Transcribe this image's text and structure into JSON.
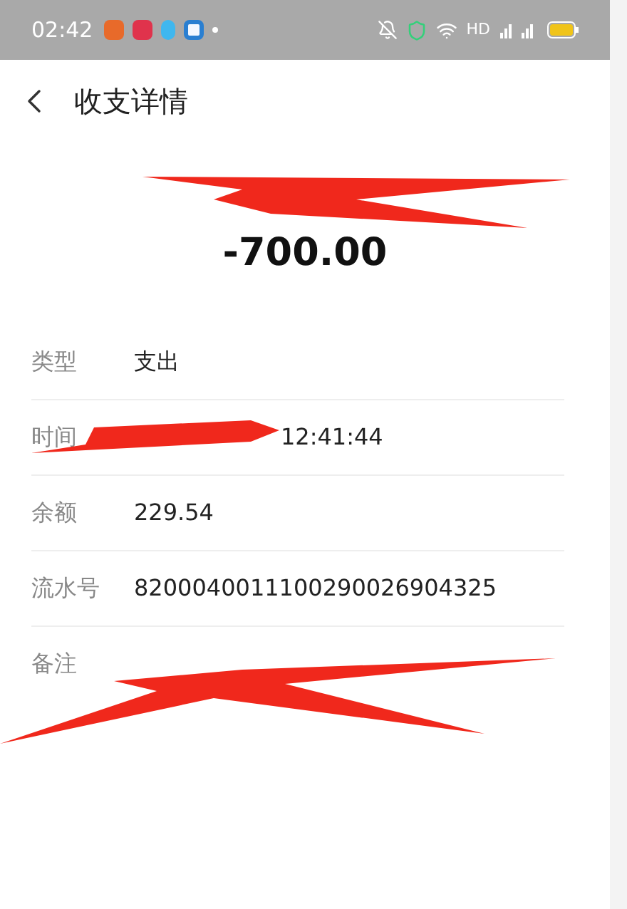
{
  "status_bar": {
    "time": "02:42",
    "network": "HD"
  },
  "header": {
    "title": "收支详情"
  },
  "summary": {
    "amount": "-700.00"
  },
  "details": [
    {
      "label": "类型",
      "value": "支出"
    },
    {
      "label": "时间",
      "value": "12:41:44"
    },
    {
      "label": "余额",
      "value": "229.54"
    },
    {
      "label": "流水号",
      "value": "8200040011100290026904325"
    },
    {
      "label": "备注"
    }
  ]
}
